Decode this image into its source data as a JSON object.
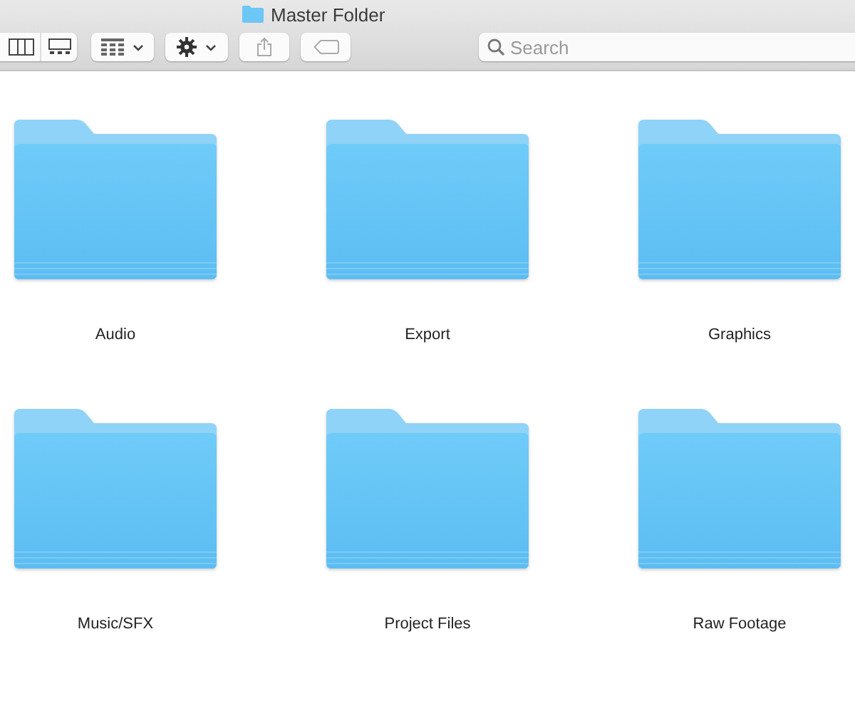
{
  "window": {
    "title": "Master Folder"
  },
  "toolbar": {
    "controls": [
      {
        "kind": "view"
      },
      {
        "kind": "arrange"
      },
      {
        "kind": "action"
      },
      {
        "kind": "share"
      },
      {
        "kind": "tags"
      }
    ],
    "search": {
      "placeholder": "Search"
    }
  },
  "folders": [
    {
      "name": "Audio"
    },
    {
      "name": "Export"
    },
    {
      "name": "Graphics"
    },
    {
      "name": "Music/SFX"
    },
    {
      "name": "Project Files"
    },
    {
      "name": "Raw Footage"
    }
  ]
}
